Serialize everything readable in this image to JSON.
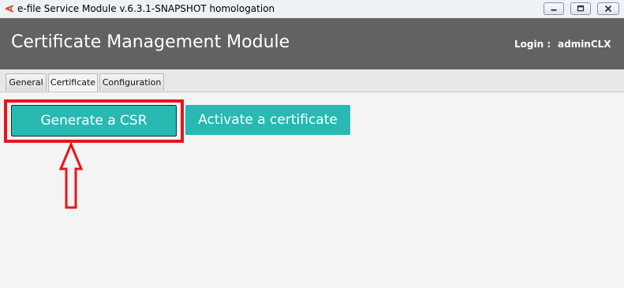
{
  "window": {
    "title": "e-file Service Module v.6.3.1-SNAPSHOT homologation",
    "controls": [
      "minimize",
      "maximize",
      "close"
    ]
  },
  "header": {
    "title": "Certificate Management Module",
    "login_label": "Login :",
    "login_user": "adminCLX"
  },
  "tabs": [
    {
      "label": "General",
      "active": false
    },
    {
      "label": "Certificate",
      "active": true
    },
    {
      "label": "Configuration",
      "active": false
    }
  ],
  "actions": {
    "generate_csr": "Generate a CSR",
    "activate_certificate": "Activate a certificate"
  },
  "colors": {
    "header_bg": "#636262",
    "button_bg": "#27b9b2",
    "highlight": "#e8151c"
  }
}
